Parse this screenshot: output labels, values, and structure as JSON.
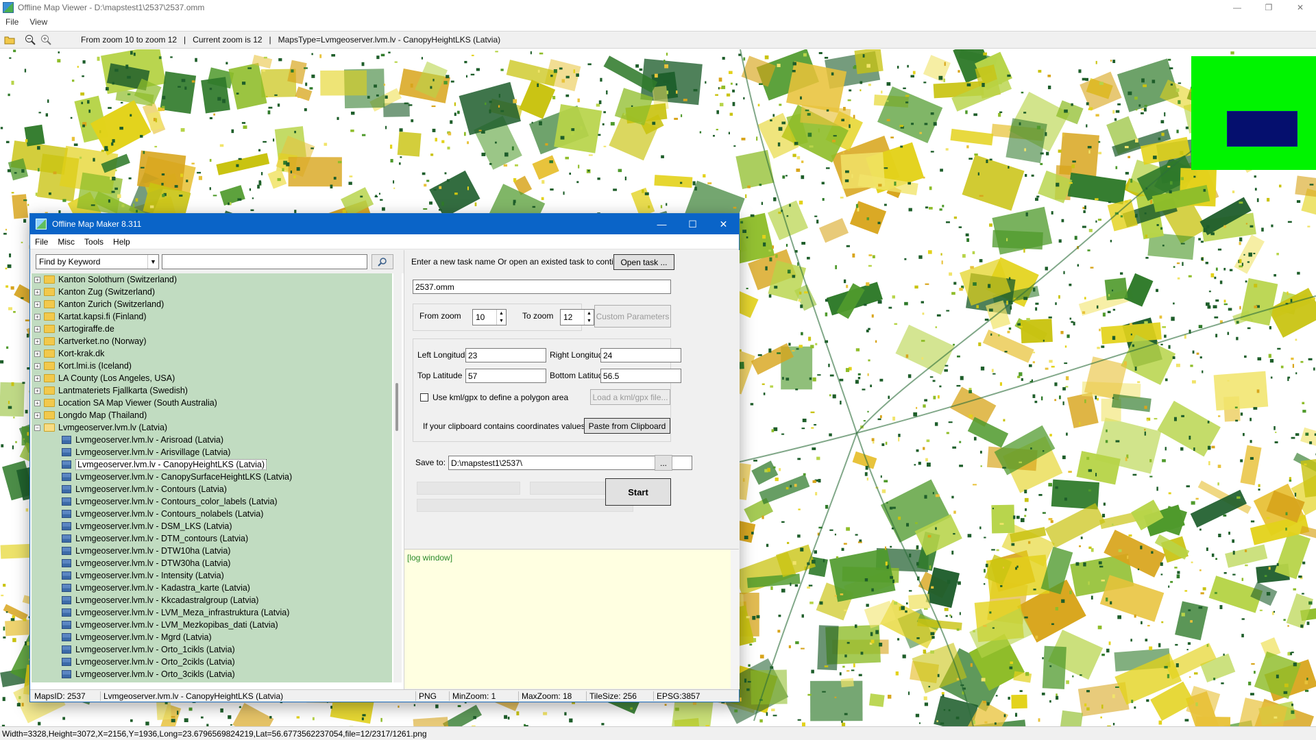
{
  "window": {
    "title": "Offline Map Viewer - D:\\mapstest1\\2537\\2537.omm"
  },
  "menu": [
    "File",
    "View"
  ],
  "toolbar": {
    "info": "From zoom 10 to zoom 12   |   Current zoom is 12   |   MapsType=Lvmgeoserver.lvm.lv - CanopyHeightLKS (Latvia)"
  },
  "icons": [
    "folder-open-icon",
    "zoom-out-icon",
    "zoom-in-icon"
  ],
  "status": {
    "text": "Width=3328,Height=3072,X=2156,Y=1936,Long=23.6796569824219,Lat=56.6773562237054,file=12/2317/1261.png"
  },
  "colors": {
    "dialog_titlebar": "#0a64c8",
    "tree_bg": "#c1dcc1",
    "log_bg": "#ffffe1",
    "minimap_bg": "#00f400",
    "minimap_viewport": "#050f6e"
  },
  "dialog": {
    "title": "Offline Map Maker 8.311",
    "menu": [
      "File",
      "Misc",
      "Tools",
      "Help"
    ],
    "search": {
      "mode": "Find by Keyword",
      "keyword": ""
    },
    "tree": {
      "folders": [
        "Kanton Solothurn (Switzerland)",
        "Kanton Zug (Switzerland)",
        "Kanton Zurich (Switzerland)",
        "Kartat.kapsi.fi (Finland)",
        "Kartogiraffe.de",
        "Kartverket.no (Norway)",
        "Kort-krak.dk",
        "Kort.lmi.is (Iceland)",
        "LA County (Los Angeles, USA)",
        "Lantmateriets Fjallkarta (Swedish)",
        "Location SA Map Viewer (South Australia)",
        "Longdo Map (Thailand)"
      ],
      "open_folder": "Lvmgeoserver.lvm.lv (Latvia)",
      "children": [
        "Lvmgeoserver.lvm.lv - Arisroad (Latvia)",
        "Lvmgeoserver.lvm.lv - Arisvillage (Latvia)",
        "Lvmgeoserver.lvm.lv - CanopyHeightLKS (Latvia)",
        "Lvmgeoserver.lvm.lv - CanopySurfaceHeightLKS (Latvia)",
        "Lvmgeoserver.lvm.lv - Contours (Latvia)",
        "Lvmgeoserver.lvm.lv - Contours_color_labels (Latvia)",
        "Lvmgeoserver.lvm.lv - Contours_nolabels (Latvia)",
        "Lvmgeoserver.lvm.lv - DSM_LKS (Latvia)",
        "Lvmgeoserver.lvm.lv - DTM_contours (Latvia)",
        "Lvmgeoserver.lvm.lv - DTW10ha (Latvia)",
        "Lvmgeoserver.lvm.lv - DTW30ha (Latvia)",
        "Lvmgeoserver.lvm.lv - Intensity (Latvia)",
        "Lvmgeoserver.lvm.lv - Kadastra_karte (Latvia)",
        "Lvmgeoserver.lvm.lv - Kkcadastralgroup (Latvia)",
        "Lvmgeoserver.lvm.lv - LVM_Meza_infrastruktura (Latvia)",
        "Lvmgeoserver.lvm.lv - LVM_Mezkopibas_dati (Latvia)",
        "Lvmgeoserver.lvm.lv - Mgrd (Latvia)",
        "Lvmgeoserver.lvm.lv - Orto_1cikls (Latvia)",
        "Lvmgeoserver.lvm.lv - Orto_2cikls (Latvia)",
        "Lvmgeoserver.lvm.lv - Orto_3cikls (Latvia)"
      ],
      "selected_index": 2
    },
    "task": {
      "prompt": "Enter a new task name Or open an existed task to continue:",
      "open_button": "Open task ...",
      "name": "2537.omm"
    },
    "zoom": {
      "from_label": "From zoom",
      "from": "10",
      "to_label": "To zoom",
      "to": "12",
      "custom_button": "Custom Parameters"
    },
    "coords": {
      "left_label": "Left Longitude",
      "left": "23",
      "right_label": "Right Longitude",
      "right": "24",
      "top_label": "Top Latitude",
      "top": "57",
      "bottom_label": "Bottom Latitude",
      "bottom": "56.5",
      "kml_label": "Use kml/gpx to define a polygon area",
      "kml_checked": false,
      "kml_button": "Load a kml/gpx file...",
      "clipboard_label": "If your clipboard contains coordinates values:",
      "clipboard_button": "Paste from Clipboard"
    },
    "save": {
      "label": "Save to:",
      "path": "D:\\mapstest1\\2537\\",
      "browse": "..."
    },
    "start_button": "Start",
    "log": "[log window]",
    "statusbar": {
      "maps_id": "MapsID: 2537",
      "map_name": "Lvmgeoserver.lvm.lv - CanopyHeightLKS (Latvia)",
      "format": "PNG",
      "min_zoom": "MinZoom: 1",
      "max_zoom": "MaxZoom: 18",
      "tile_size": "TileSize: 256",
      "epsg": "EPSG:3857"
    }
  }
}
